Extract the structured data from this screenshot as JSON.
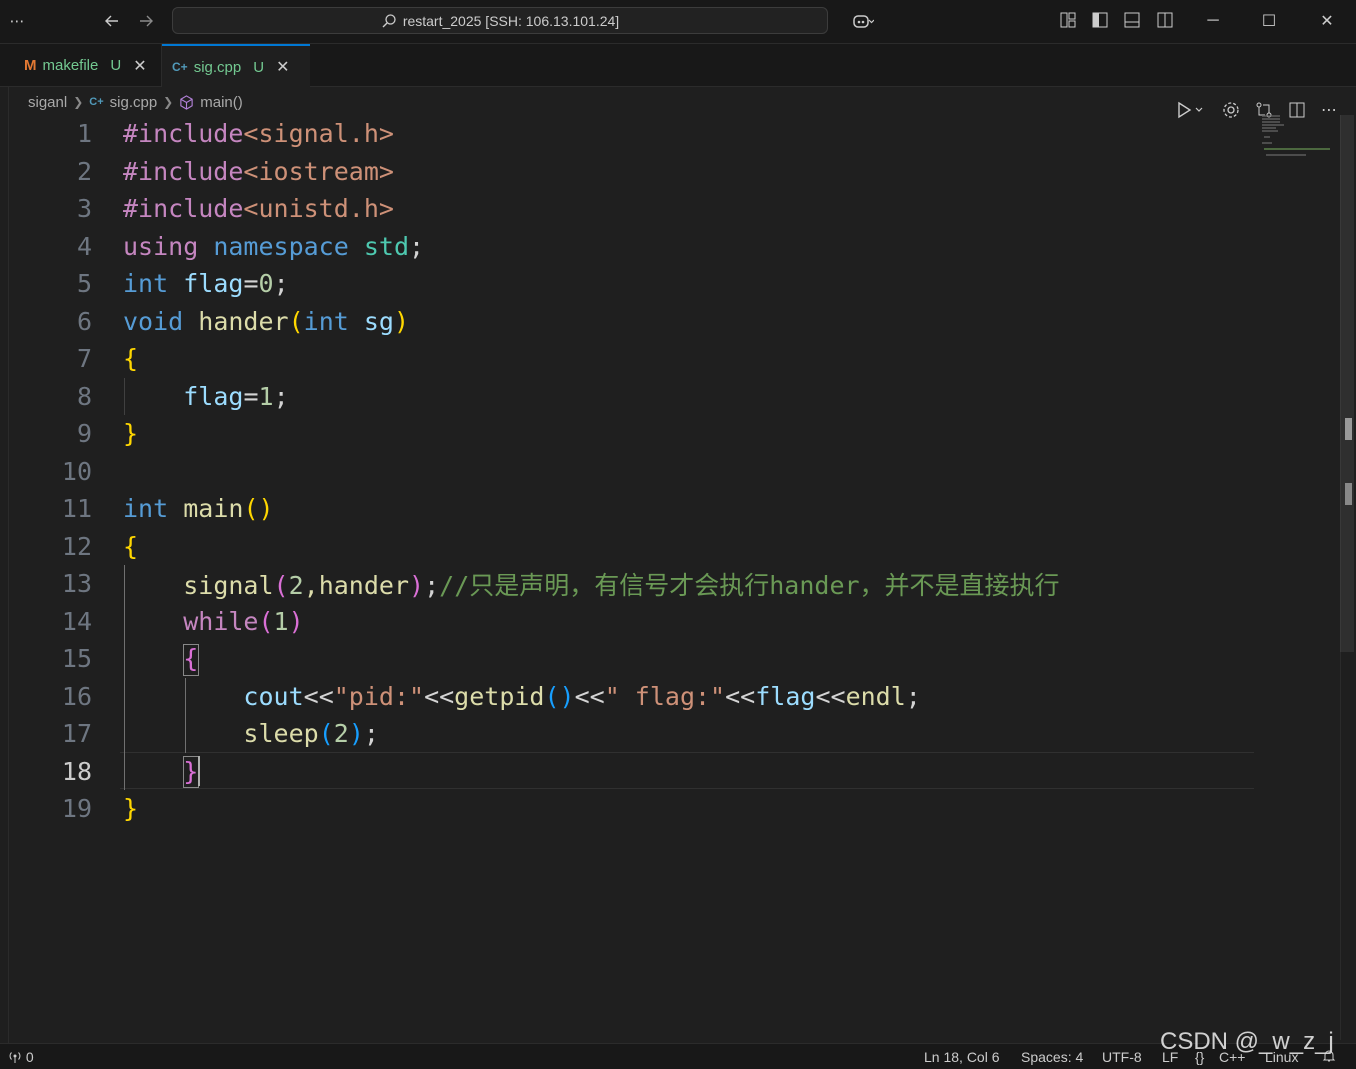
{
  "titlebar": {
    "menu_icon": "ellipsis-icon",
    "back_icon": "arrow-left-icon",
    "forward_icon": "arrow-right-icon",
    "search_text": "restart_2025 [SSH: 106.13.101.24]",
    "copilot_icon": "copilot-icon",
    "window": {
      "minimize": "─",
      "maximize": "☐",
      "close": "✕"
    }
  },
  "tabs": [
    {
      "icon": "M",
      "label": "makefile",
      "status": "U",
      "close": "✕"
    },
    {
      "icon": "C+",
      "label": "sig.cpp",
      "status": "U",
      "close": "✕"
    }
  ],
  "breadcrumb": {
    "folder": "siganl",
    "file": "sig.cpp",
    "symbol": "main()"
  },
  "editor": {
    "current_line": 18,
    "lines": [
      "1",
      "2",
      "3",
      "4",
      "5",
      "6",
      "7",
      "8",
      "9",
      "10",
      "11",
      "12",
      "13",
      "14",
      "15",
      "16",
      "17",
      "18",
      "19"
    ]
  },
  "code": {
    "l1": {
      "a": "#include",
      "b": "<signal.h>"
    },
    "l2": {
      "a": "#include",
      "b": "<iostream>"
    },
    "l3": {
      "a": "#include",
      "b": "<unistd.h>"
    },
    "l4": {
      "a": "using",
      "b": "namespace",
      "c": "std",
      "d": ";"
    },
    "l5": {
      "a": "int",
      "b": "flag",
      "c": "=",
      "d": "0",
      "e": ";"
    },
    "l6": {
      "a": "void",
      "b": "hander",
      "c": "(",
      "d": "int",
      "e": "sg",
      "f": ")"
    },
    "l7": {
      "a": "{"
    },
    "l8": {
      "a": "flag",
      "b": "=",
      "c": "1",
      "d": ";"
    },
    "l9": {
      "a": "}"
    },
    "l11": {
      "a": "int",
      "b": "main",
      "c": "()"
    },
    "l12": {
      "a": "{"
    },
    "l13": {
      "a": "signal",
      "b": "(",
      "c": "2",
      "d": ",hander",
      "e": ")",
      "f": ";",
      "g": "//只是声明，有信号才会执行hander，并不是直接执行"
    },
    "l14": {
      "a": "while",
      "b": "(",
      "c": "1",
      "d": ")"
    },
    "l15": {
      "a": "{"
    },
    "l16": {
      "a": "cout",
      "b": "<<",
      "c": "\"pid:\"",
      "d": "<<",
      "e": "getpid",
      "f": "()",
      "g": "<<",
      "h": "\" flag:\"",
      "i": "<<",
      "j": "flag",
      "k": "<<",
      "l": "endl",
      "m": ";"
    },
    "l17": {
      "a": "sleep",
      "b": "(",
      "c": "2",
      "d": ")",
      "e": ";"
    },
    "l18": {
      "a": "}"
    },
    "l19": {
      "a": "}"
    }
  },
  "statusbar": {
    "remote": "0",
    "position": "Ln 18, Col 6",
    "spaces": "Spaces: 4",
    "encoding": "UTF-8",
    "eol": "LF",
    "braces": "{}",
    "language": "C++",
    "os": "Linux"
  },
  "watermark": "CSDN @_w_z_j"
}
